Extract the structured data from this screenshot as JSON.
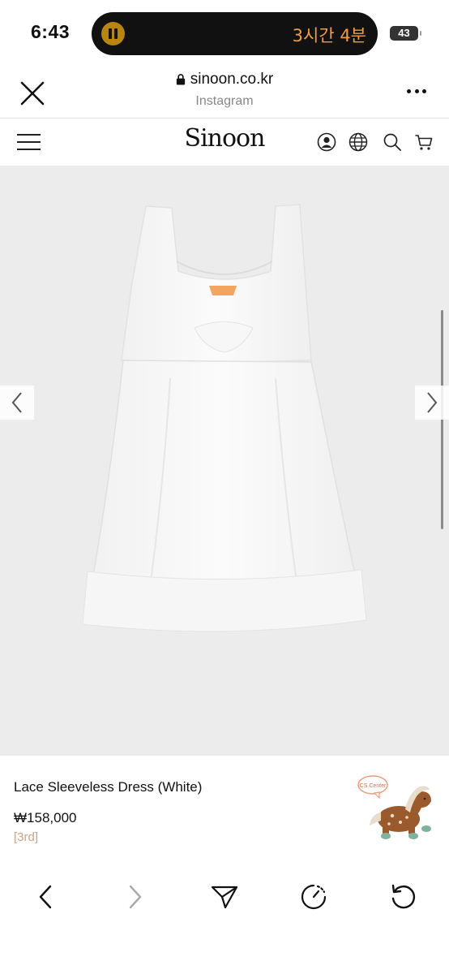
{
  "status": {
    "time": "6:43",
    "island_timer": "3시간 4분",
    "battery": "43"
  },
  "browser": {
    "url": "sinoon.co.kr",
    "source": "Instagram"
  },
  "site": {
    "logo": "Sinoon"
  },
  "product": {
    "name": "Lace Sleeveless Dress (White)",
    "price": "₩158,000",
    "tag": "[3rd]",
    "cs_label": "CS Center"
  },
  "colors": {
    "accent_orange": "#f39c3c",
    "tag_color": "#c9a486",
    "image_bg": "#ececec"
  },
  "icons": {
    "close": "close-icon",
    "more": "more-icon",
    "menu": "hamburger-icon",
    "account": "account-icon",
    "language": "globe-icon",
    "search": "search-icon",
    "cart": "cart-icon",
    "prev": "chevron-left-icon",
    "next": "chevron-right-icon",
    "share": "share-icon",
    "speed": "gauge-icon",
    "reload": "reload-icon"
  }
}
